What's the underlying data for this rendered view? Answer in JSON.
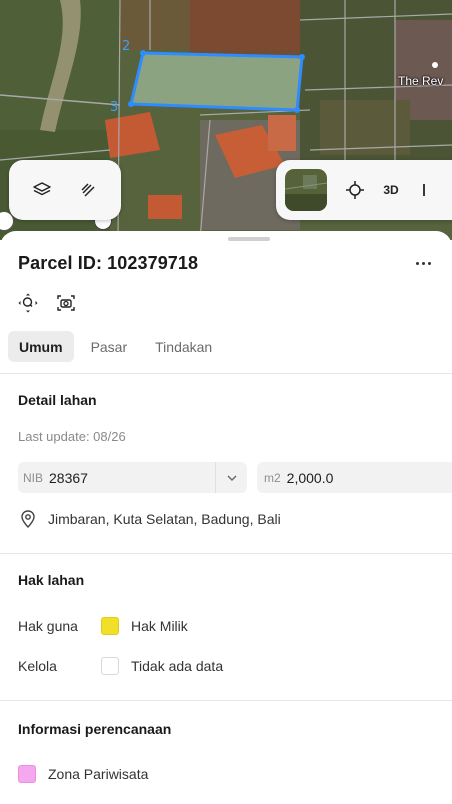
{
  "map": {
    "parcel_vertex_labels": [
      "2",
      "3"
    ],
    "place_label": "The Rev",
    "three_d_label": "3D",
    "colors": {
      "parcel_outline": "#2e8cff",
      "parcel_fill": "#9fb89a"
    }
  },
  "parcel": {
    "title": "Parcel ID: 102379718"
  },
  "tabs": [
    {
      "label": "Umum",
      "active": true
    },
    {
      "label": "Pasar",
      "active": false
    },
    {
      "label": "Tindakan",
      "active": false
    }
  ],
  "detail": {
    "heading": "Detail lahan",
    "last_update": "Last update: 08/26",
    "nib_prefix": "NIB",
    "nib_value": "28367",
    "area_prefix": "m2",
    "area_value": "2,000.0",
    "location": "Jimbaran, Kuta Selatan, Badung, Bali"
  },
  "rights": {
    "heading": "Hak lahan",
    "rows": [
      {
        "key": "Hak guna",
        "value": "Hak Milik",
        "color": "#f2df2a"
      },
      {
        "key": "Kelola",
        "value": "Tidak ada data",
        "color": "#ffffff"
      }
    ]
  },
  "planning": {
    "heading": "Informasi perencanaan",
    "zone": "Zona Pariwisata",
    "zone_color": "#f6a8ee"
  },
  "icons": [
    "layers-icon",
    "satellite-icon",
    "search-zoom-icon",
    "camera-icon",
    "location-pin-icon",
    "chevron-down-icon",
    "more-icon",
    "crosshair-icon"
  ]
}
